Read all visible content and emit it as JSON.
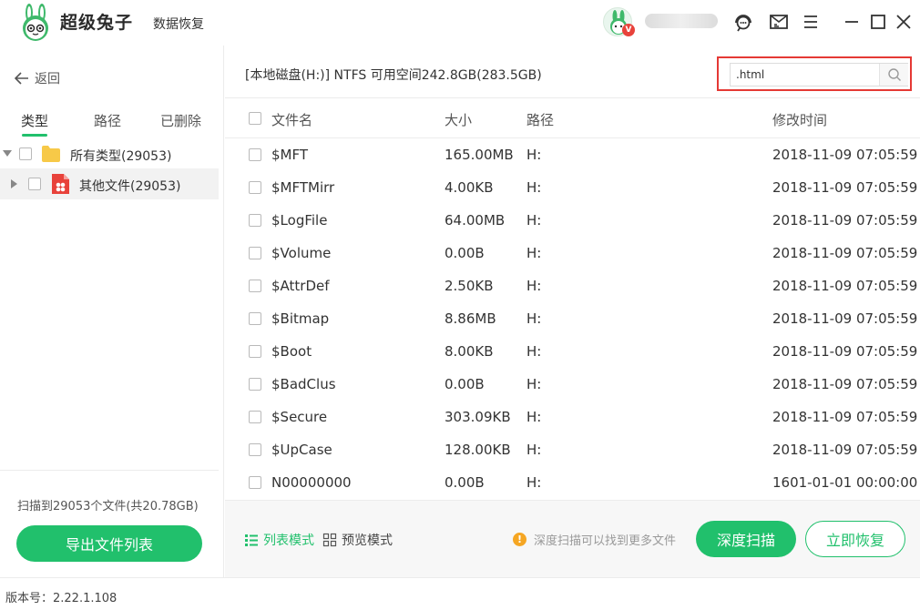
{
  "app": {
    "brand_name": "超级兔子",
    "product_name": "数据恢复",
    "vip_badge": "V"
  },
  "sidebar": {
    "back_label": "返回",
    "tabs": [
      {
        "label": "类型",
        "active": true
      },
      {
        "label": "路径",
        "active": false
      },
      {
        "label": "已删除",
        "active": false
      }
    ],
    "tree": [
      {
        "label": "所有类型(29053)",
        "icon": "folder-icon",
        "expanded": true,
        "level": 0
      },
      {
        "label": "其他文件(29053)",
        "icon": "other-file-icon",
        "expanded": false,
        "level": 1
      }
    ],
    "scan_summary": "扫描到29053个文件(共20.78GB)",
    "export_label": "导出文件列表"
  },
  "main": {
    "disk_info": "[本地磁盘(H:)] NTFS 可用空间242.8GB(283.5GB)",
    "search": {
      "value": ".html"
    },
    "columns": {
      "name": "文件名",
      "size": "大小",
      "path": "路径",
      "modified": "修改时间"
    },
    "files": [
      {
        "name": "$MFT",
        "size": "165.00MB",
        "path": "H:",
        "modified": "2018-11-09 07:05:59"
      },
      {
        "name": "$MFTMirr",
        "size": "4.00KB",
        "path": "H:",
        "modified": "2018-11-09 07:05:59"
      },
      {
        "name": "$LogFile",
        "size": "64.00MB",
        "path": "H:",
        "modified": "2018-11-09 07:05:59"
      },
      {
        "name": "$Volume",
        "size": "0.00B",
        "path": "H:",
        "modified": "2018-11-09 07:05:59"
      },
      {
        "name": "$AttrDef",
        "size": "2.50KB",
        "path": "H:",
        "modified": "2018-11-09 07:05:59"
      },
      {
        "name": "$Bitmap",
        "size": "8.86MB",
        "path": "H:",
        "modified": "2018-11-09 07:05:59"
      },
      {
        "name": "$Boot",
        "size": "8.00KB",
        "path": "H:",
        "modified": "2018-11-09 07:05:59"
      },
      {
        "name": "$BadClus",
        "size": "0.00B",
        "path": "H:",
        "modified": "2018-11-09 07:05:59"
      },
      {
        "name": "$Secure",
        "size": "303.09KB",
        "path": "H:",
        "modified": "2018-11-09 07:05:59"
      },
      {
        "name": "$UpCase",
        "size": "128.00KB",
        "path": "H:",
        "modified": "2018-11-09 07:05:59"
      },
      {
        "name": "N00000000",
        "size": "0.00B",
        "path": "H:",
        "modified": "1601-01-01 00:00:00"
      }
    ]
  },
  "bottom": {
    "list_mode_label": "列表模式",
    "preview_mode_label": "预览模式",
    "hint": "深度扫描可以找到更多文件",
    "hint_icon": "!",
    "deep_scan_label": "深度扫描",
    "recover_label": "立即恢复"
  },
  "status": {
    "version": "版本号：2.22.1.108"
  },
  "colors": {
    "accent": "#21c06c",
    "highlight": "#e53935",
    "warning": "#f5a623"
  }
}
